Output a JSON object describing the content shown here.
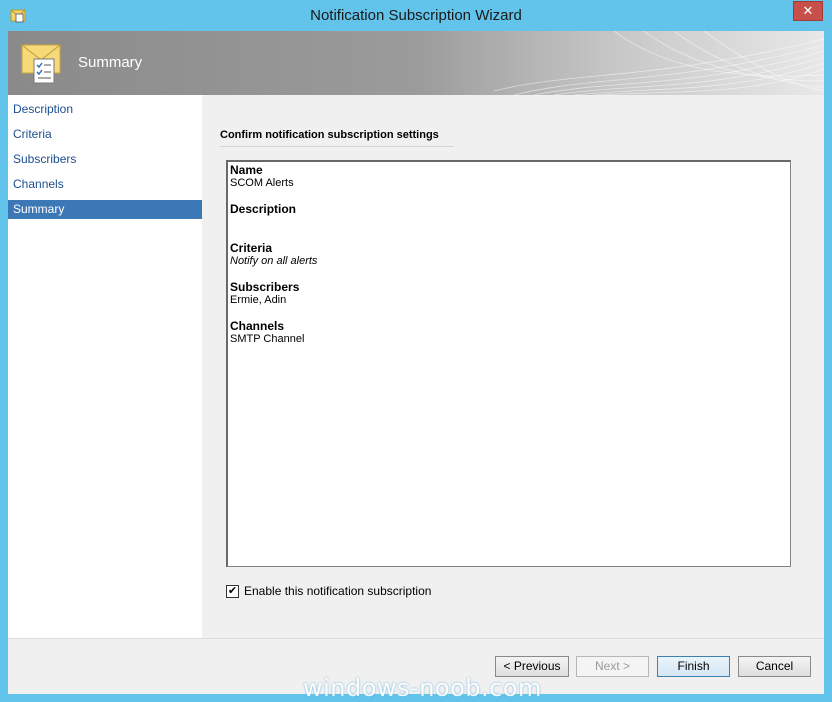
{
  "window": {
    "title": "Notification Subscription Wizard",
    "close_glyph": "✕"
  },
  "header": {
    "title": "Summary"
  },
  "nav": {
    "items": [
      {
        "label": "Description",
        "selected": false
      },
      {
        "label": "Criteria",
        "selected": false
      },
      {
        "label": "Subscribers",
        "selected": false
      },
      {
        "label": "Channels",
        "selected": false
      },
      {
        "label": "Summary",
        "selected": true
      }
    ]
  },
  "content": {
    "heading": "Confirm notification subscription settings",
    "summary": {
      "name_label": "Name",
      "name_value": "SCOM Alerts",
      "description_label": "Description",
      "description_value": "",
      "criteria_label": "Criteria",
      "criteria_value": "Notify on all alerts",
      "subscribers_label": "Subscribers",
      "subscribers_value": "Ermie, Adin",
      "channels_label": "Channels",
      "channels_value": "SMTP Channel"
    },
    "enable_checkbox": {
      "label": "Enable this notification subscription",
      "checked": true,
      "mark": "✔"
    }
  },
  "footer": {
    "previous_label": "< Previous",
    "next_label": "Next >",
    "finish_label": "Finish",
    "cancel_label": "Cancel"
  },
  "watermark": {
    "text": "windows-noob.com"
  },
  "colors": {
    "titlebar": "#62c4ea",
    "nav_selected": "#3c78b5",
    "nav_link": "#1c4f8f",
    "close_button": "#c7504b"
  }
}
